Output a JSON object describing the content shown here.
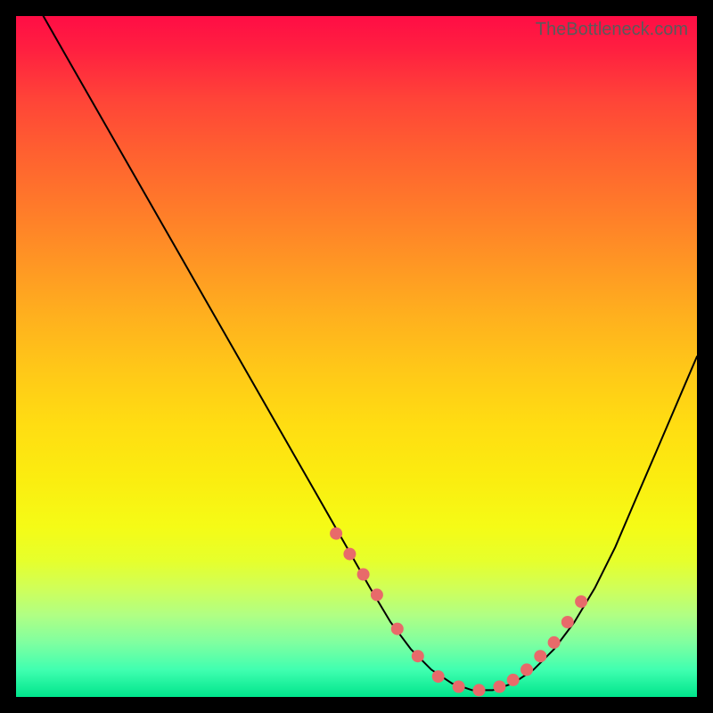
{
  "watermark": "TheBottleneck.com",
  "chart_data": {
    "type": "line",
    "title": "",
    "xlabel": "",
    "ylabel": "",
    "xlim": [
      0,
      100
    ],
    "ylim": [
      0,
      100
    ],
    "grid": false,
    "legend": false,
    "series": [
      {
        "name": "bottleneck-curve",
        "x": [
          4,
          8,
          12,
          16,
          20,
          24,
          28,
          32,
          36,
          40,
          44,
          48,
          52,
          55,
          58,
          61,
          64,
          67,
          70,
          73,
          76,
          79,
          82,
          85,
          88,
          91,
          94,
          97,
          100
        ],
        "y": [
          100,
          93,
          86,
          79,
          72,
          65,
          58,
          51,
          44,
          37,
          30,
          23,
          16,
          11,
          7,
          4,
          2,
          1,
          1,
          2,
          4,
          7,
          11,
          16,
          22,
          29,
          36,
          43,
          50
        ]
      }
    ],
    "markers": {
      "name": "highlight-dots",
      "x": [
        47,
        49,
        51,
        53,
        56,
        59,
        62,
        65,
        68,
        71,
        73,
        75,
        77,
        79,
        81,
        83
      ],
      "y": [
        24,
        21,
        18,
        15,
        10,
        6,
        3,
        1.5,
        1,
        1.5,
        2.5,
        4,
        6,
        8,
        11,
        14
      ]
    }
  }
}
